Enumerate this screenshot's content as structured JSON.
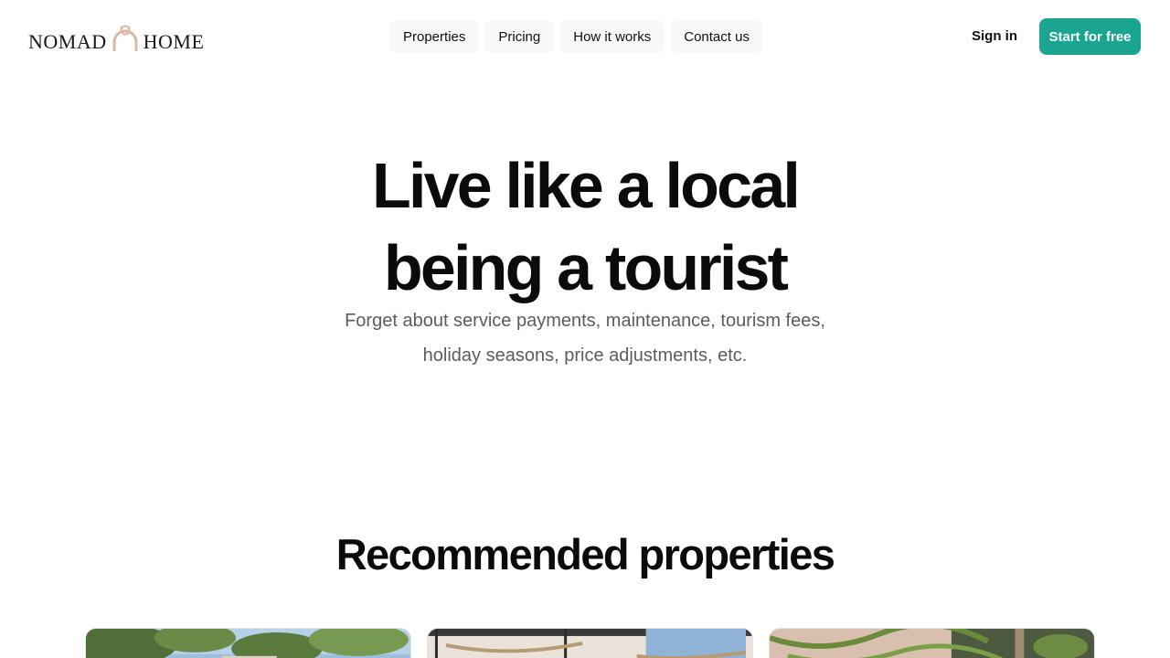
{
  "header": {
    "logo_left": "NOMAD",
    "logo_right": "HOME",
    "nav": [
      "Properties",
      "Pricing",
      "How it works",
      "Contact us"
    ],
    "signin_label": "Sign in",
    "cta_label": "Start for free"
  },
  "hero": {
    "title_line1": "Live like a local",
    "title_line2": "being a tourist",
    "subtitle_line1": "Forget about service payments, maintenance, tourism fees,",
    "subtitle_line2": "holiday seasons, price adjustments, etc."
  },
  "recommended": {
    "title": "Recommended properties"
  },
  "colors": {
    "accent": "#1aa590",
    "logo_mark": "#d8b8a8",
    "subtitle": "#5c5c5c"
  },
  "icons": {
    "logo_mark": "arch-knot-icon"
  }
}
